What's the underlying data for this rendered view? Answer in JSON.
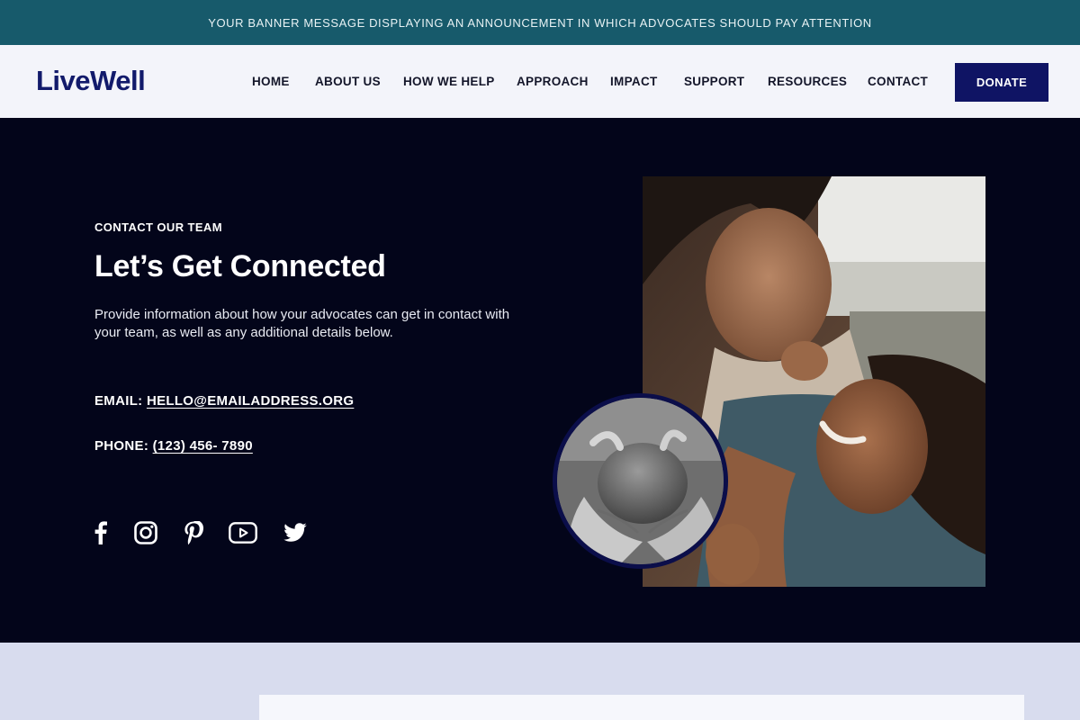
{
  "banner": {
    "message": "YOUR BANNER MESSAGE DISPLAYING AN ANNOUNCEMENT IN WHICH ADVOCATES SHOULD PAY ATTENTION"
  },
  "header": {
    "logo": "LiveWell",
    "nav": [
      "HOME",
      "ABOUT US",
      "HOW WE HELP",
      "APPROACH",
      "IMPACT",
      "SUPPORT",
      "RESOURCES",
      "CONTACT"
    ],
    "donate_label": "DONATE"
  },
  "hero": {
    "eyebrow": "CONTACT OUR TEAM",
    "heading": "Let’s Get Connected",
    "description": "Provide information about how your advocates can get in contact with your team, as well as any additional details below.",
    "email_label": "EMAIL:",
    "email_value": "HELLO@EMAILADDRESS.ORG",
    "phone_label": "PHONE:",
    "phone_value": "(123) 456- 7890",
    "socials": [
      "facebook-icon",
      "instagram-icon",
      "pinterest-icon",
      "youtube-icon",
      "twitter-icon"
    ]
  },
  "colors": {
    "banner": "#175a6b",
    "header_bg": "#f3f4fa",
    "brand_navy": "#0f1464",
    "hero_bg": "#03051a",
    "lower_bg": "#d8dcee"
  }
}
